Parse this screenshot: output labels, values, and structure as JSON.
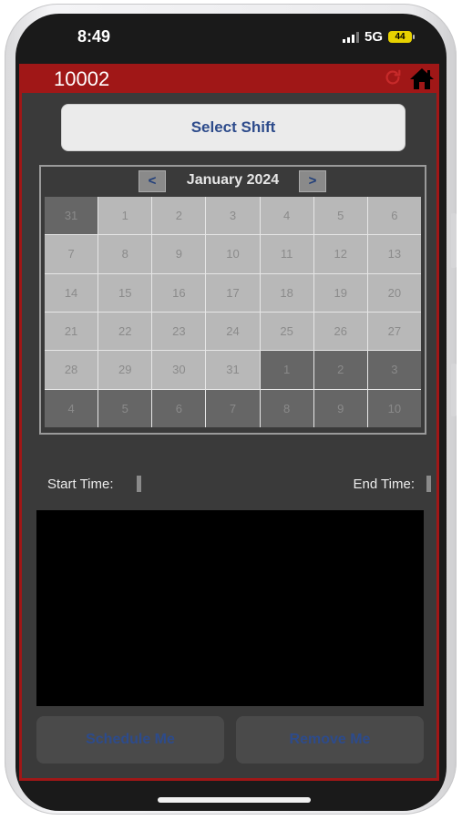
{
  "status_bar": {
    "time": "8:49",
    "network": "5G",
    "battery": "44"
  },
  "header": {
    "title": "10002"
  },
  "select_shift_label": "Select Shift",
  "calendar": {
    "prev": "<",
    "next": ">",
    "month_label": "January 2024",
    "days": [
      {
        "d": "31",
        "out": true
      },
      {
        "d": "1",
        "out": false
      },
      {
        "d": "2",
        "out": false
      },
      {
        "d": "3",
        "out": false
      },
      {
        "d": "4",
        "out": false
      },
      {
        "d": "5",
        "out": false
      },
      {
        "d": "6",
        "out": false
      },
      {
        "d": "7",
        "out": false
      },
      {
        "d": "8",
        "out": false
      },
      {
        "d": "9",
        "out": false
      },
      {
        "d": "10",
        "out": false
      },
      {
        "d": "11",
        "out": false
      },
      {
        "d": "12",
        "out": false
      },
      {
        "d": "13",
        "out": false
      },
      {
        "d": "14",
        "out": false
      },
      {
        "d": "15",
        "out": false
      },
      {
        "d": "16",
        "out": false
      },
      {
        "d": "17",
        "out": false
      },
      {
        "d": "18",
        "out": false
      },
      {
        "d": "19",
        "out": false
      },
      {
        "d": "20",
        "out": false
      },
      {
        "d": "21",
        "out": false
      },
      {
        "d": "22",
        "out": false
      },
      {
        "d": "23",
        "out": false
      },
      {
        "d": "24",
        "out": false
      },
      {
        "d": "25",
        "out": false
      },
      {
        "d": "26",
        "out": false
      },
      {
        "d": "27",
        "out": false
      },
      {
        "d": "28",
        "out": false
      },
      {
        "d": "29",
        "out": false
      },
      {
        "d": "30",
        "out": false
      },
      {
        "d": "31",
        "out": false
      },
      {
        "d": "1",
        "out": true
      },
      {
        "d": "2",
        "out": true
      },
      {
        "d": "3",
        "out": true
      },
      {
        "d": "4",
        "out": true
      },
      {
        "d": "5",
        "out": true
      },
      {
        "d": "6",
        "out": true
      },
      {
        "d": "7",
        "out": true
      },
      {
        "d": "8",
        "out": true
      },
      {
        "d": "9",
        "out": true
      },
      {
        "d": "10",
        "out": true
      }
    ]
  },
  "times": {
    "start_label": "Start Time:",
    "end_label": "End Time:"
  },
  "buttons": {
    "schedule": "Schedule Me",
    "remove": "Remove Me"
  },
  "colors": {
    "header_red": "#a01717",
    "button_text": "#2d4b8b"
  }
}
